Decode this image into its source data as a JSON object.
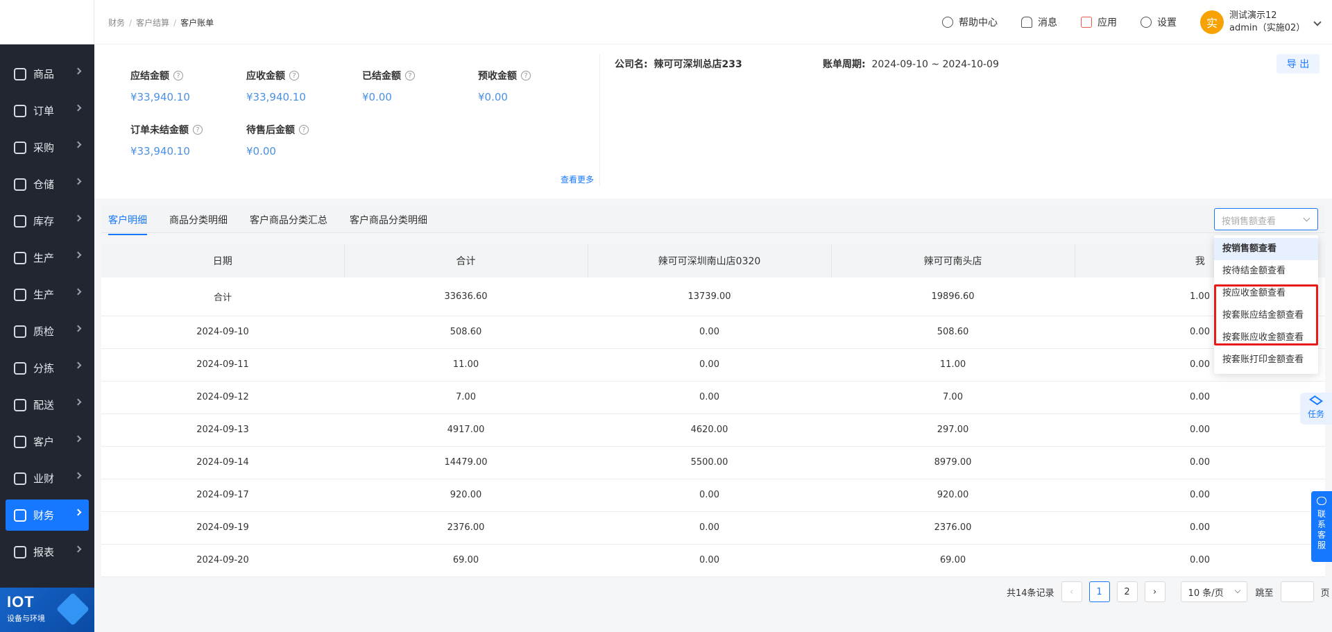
{
  "sidebar": {
    "items": [
      {
        "label": "商品",
        "icon": "grid-icon"
      },
      {
        "label": "订单",
        "icon": "clipboard-icon"
      },
      {
        "label": "采购",
        "icon": "basket-icon"
      },
      {
        "label": "仓储",
        "icon": "warehouse-icon"
      },
      {
        "label": "库存",
        "icon": "home-icon"
      },
      {
        "label": "生产",
        "icon": "factory-icon"
      },
      {
        "label": "生产",
        "icon": "factory-icon"
      },
      {
        "label": "质检",
        "icon": "shield-icon"
      },
      {
        "label": "分拣",
        "icon": "sort-icon"
      },
      {
        "label": "配送",
        "icon": "truck-icon"
      },
      {
        "label": "客户",
        "icon": "user-icon"
      },
      {
        "label": "业财",
        "icon": "chart-icon"
      },
      {
        "label": "财务",
        "icon": "wallet-icon",
        "active": true
      },
      {
        "label": "报表",
        "icon": "pie-icon"
      }
    ],
    "footer": {
      "title": "IOT",
      "subtitle": "设备与环境"
    }
  },
  "breadcrumb": [
    "财务",
    "客户结算",
    "客户账单"
  ],
  "topbar": {
    "help": "帮助中心",
    "messages": "消息",
    "apps": "应用",
    "settings": "设置",
    "user_avatar": "实",
    "user_name": "测试演示12",
    "user_account": "admin（实施02）"
  },
  "summary": {
    "metrics": [
      {
        "label": "应结金额",
        "value": "¥33,940.10"
      },
      {
        "label": "应收金额",
        "value": "¥33,940.10"
      },
      {
        "label": "已结金额",
        "value": "¥0.00"
      },
      {
        "label": "预收金额",
        "value": "¥0.00"
      },
      {
        "label": "订单未结金额",
        "value": "¥33,940.10"
      },
      {
        "label": "待售后金额",
        "value": "¥0.00"
      }
    ],
    "see_more": "查看更多",
    "company_label": "公司名:",
    "company_value": "辣可可深圳总店233",
    "period_label": "账单周期:",
    "period_value": "2024-09-10 ~ 2024-10-09",
    "export": "导 出"
  },
  "tabs": [
    "客户明细",
    "商品分类明细",
    "客户商品分类汇总",
    "客户商品分类明细"
  ],
  "select": {
    "placeholder": "按销售额查看",
    "options": [
      "按销售额查看",
      "按待结金额查看",
      "按应收金额查看",
      "按套账应结金额查看",
      "按套账应收金额查看",
      "按套账打印金额查看"
    ]
  },
  "table": {
    "headers": [
      "日期",
      "合计",
      "辣可可深圳南山店0320",
      "辣可可南头店",
      "我"
    ],
    "rows": [
      [
        "合计",
        "33636.60",
        "13739.00",
        "19896.60",
        "1.00"
      ],
      [
        "2024-09-10",
        "508.60",
        "0.00",
        "508.60",
        "0.00"
      ],
      [
        "2024-09-11",
        "11.00",
        "0.00",
        "11.00",
        "0.00"
      ],
      [
        "2024-09-12",
        "7.00",
        "0.00",
        "7.00",
        "0.00"
      ],
      [
        "2024-09-13",
        "4917.00",
        "4620.00",
        "297.00",
        "0.00"
      ],
      [
        "2024-09-14",
        "14479.00",
        "5500.00",
        "8979.00",
        "0.00"
      ],
      [
        "2024-09-17",
        "920.00",
        "0.00",
        "920.00",
        "0.00"
      ],
      [
        "2024-09-19",
        "2376.00",
        "0.00",
        "2376.00",
        "0.00"
      ],
      [
        "2024-09-20",
        "69.00",
        "0.00",
        "69.00",
        "0.00"
      ]
    ]
  },
  "floating": {
    "task": "任务",
    "contact": [
      "联",
      "系",
      "客",
      "服"
    ]
  },
  "pagination": {
    "total": "共14条记录",
    "prev": "‹",
    "pages": [
      "1",
      "2"
    ],
    "next": "›",
    "page_size": "10 条/页",
    "jump_label": "跳至",
    "page_unit": "页"
  },
  "colors": {
    "accent": "#1677ff",
    "sidebar_bg": "#212631",
    "value_blue": "#4a90e2",
    "highlight_red": "#e81919"
  }
}
